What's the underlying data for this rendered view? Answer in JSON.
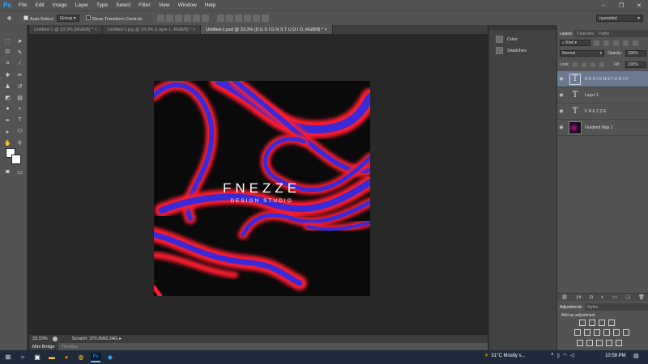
{
  "app": {
    "logo": "Ps",
    "menus": [
      "File",
      "Edit",
      "Image",
      "Layer",
      "Type",
      "Select",
      "Filter",
      "View",
      "Window",
      "Help"
    ],
    "window_controls": [
      "–",
      "❐",
      "✕"
    ]
  },
  "options_bar": {
    "auto_select_label": "Auto-Select:",
    "auto_select_value": "Group",
    "show_transform_label": "Show Transform Controls",
    "workspace": "nyxnmlol"
  },
  "doc_tabs": [
    {
      "label": "Untitled-1 @ 33.3% (RGB/8) *",
      "active": false
    },
    {
      "label": "Untitled-1.jpg @ 33.3% (Layer 1, RGB/8) *",
      "active": false
    },
    {
      "label": "Untitled-1.psd @ 33.3% (D E S I G N  S T U D I O, RGB/8) *",
      "active": true
    }
  ],
  "artwork": {
    "headline": "FNEZZE",
    "subline": "DESIGN STUDIO"
  },
  "status": {
    "zoom": "33.33%",
    "scratch": "Scratch: 370.2M/2.24G"
  },
  "bottom_tabs": [
    "Mini Bridge",
    "Timeline"
  ],
  "mid_dock": [
    {
      "label": "Color",
      "icon": "color-icon"
    },
    {
      "label": "Swatches",
      "icon": "swatches-icon"
    }
  ],
  "layers_panel": {
    "tabs": [
      "Layers",
      "Channels",
      "Paths"
    ],
    "kind_filter": "Kind",
    "blend_mode": "Normal",
    "opacity_label": "Opacity:",
    "opacity_value": "100%",
    "lock_label": "Lock:",
    "fill_label": "Fill:",
    "fill_value": "100%",
    "layers": [
      {
        "name": "D E S I G N   S T U D I O",
        "type": "text",
        "selected": true
      },
      {
        "name": "Layer 1",
        "type": "text",
        "selected": false
      },
      {
        "name": "F N E Z Z E",
        "type": "text",
        "selected": false
      },
      {
        "name": "Gradient Map 1",
        "type": "image",
        "selected": false
      }
    ]
  },
  "adjustments_panel": {
    "tabs": [
      "Adjustments",
      "Styles"
    ],
    "heading": "Add an adjustment"
  },
  "taskbar": {
    "weather": "31°C  Mostly s...",
    "time": "10:58 PM"
  }
}
